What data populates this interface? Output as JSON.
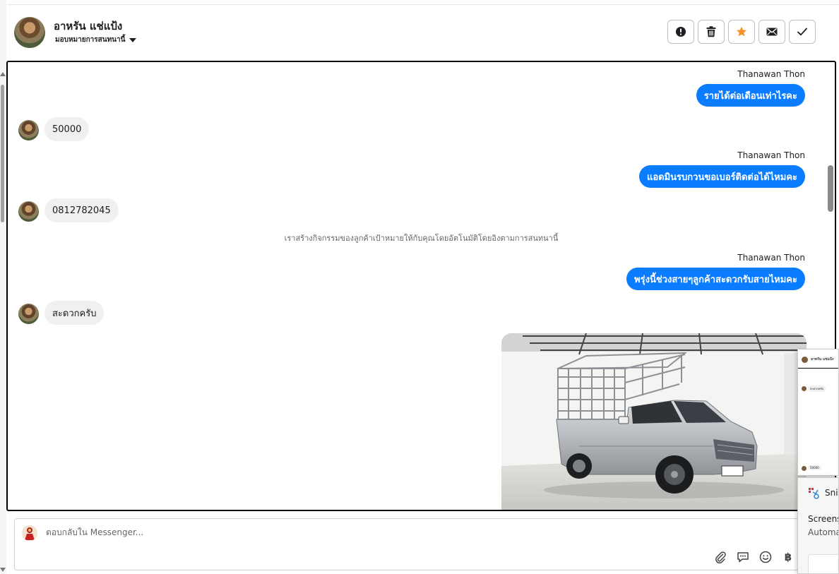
{
  "header": {
    "name": "อาหรัน แช่แป้ง",
    "assign_label": "มอบหมายการสนทนานี้"
  },
  "actions": [
    {
      "name": "report-button",
      "icon": "exclamation-circle-icon"
    },
    {
      "name": "delete-button",
      "icon": "trash-icon"
    },
    {
      "name": "star-button",
      "icon": "star-icon",
      "color": "#f5922e"
    },
    {
      "name": "mark-unread-button",
      "icon": "envelope-icon"
    },
    {
      "name": "mark-done-button",
      "icon": "checkmark-icon"
    }
  ],
  "messages": {
    "out1": {
      "sender": "Thanawan Thon",
      "text": "รายได้ต่อเดือนเท่าไรคะ"
    },
    "in1": {
      "text": "50000"
    },
    "out2": {
      "sender": "Thanawan Thon",
      "text": "แอดมินรบกวนขอเบอร์ติดต่อได้ไหมคะ"
    },
    "in2": {
      "text": "0812782045"
    },
    "system": {
      "text": "เราสร้างกิจกรรมของลูกค้าเป้าหมายให้กับคุณโดยอัตโนมัติโดยอิงตามการสนทนานี้"
    },
    "out3": {
      "sender": "Thanawan Thon",
      "text": "พรุ่งนี้ช่วงสายๆลูกค้าสะดวกรับสายไหมคะ"
    },
    "in3": {
      "text": "สะดวกครับ"
    }
  },
  "composer": {
    "placeholder": "ตอบกลับใน Messenger...",
    "currency_symbol": "฿"
  },
  "mini_window": {
    "name": "อาหรัน แช่แป้ง",
    "bubble1": "สะดวกครับ",
    "bubble2": "50000"
  },
  "toast": {
    "title": "Snip",
    "line1": "Screens",
    "line2": "Automa"
  },
  "colors": {
    "accent": "#0a7cff",
    "incoming_bubble": "#f0f0f0",
    "star": "#f5922e"
  }
}
